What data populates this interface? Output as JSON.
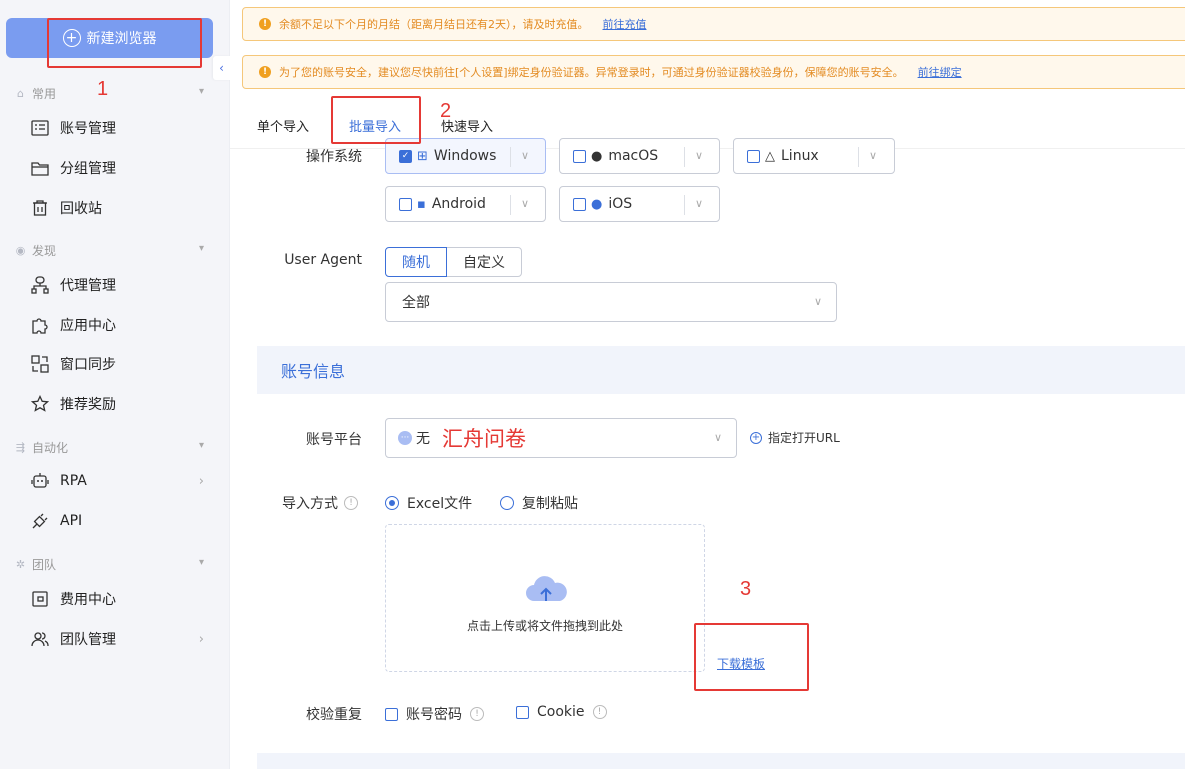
{
  "sidebar": {
    "new_browser": "新建浏览器",
    "groups": [
      {
        "label": "常用",
        "items": [
          "账号管理",
          "分组管理",
          "回收站"
        ]
      },
      {
        "label": "发现",
        "items": [
          "代理管理",
          "应用中心",
          "窗口同步",
          "推荐奖励"
        ]
      },
      {
        "label": "自动化",
        "items": [
          "RPA",
          "API"
        ]
      },
      {
        "label": "团队",
        "items": [
          "费用中心",
          "团队管理"
        ]
      }
    ]
  },
  "alerts": {
    "balance": {
      "text": "余额不足以下个月的月结（距离月结日还有2天），请及时充值。",
      "link": "前往充值"
    },
    "security": {
      "text": "为了您的账号安全，建议您尽快前往[个人设置]绑定身份验证器。异常登录时，可通过身份验证器校验身份，保障您的账号安全。",
      "link": "前往绑定"
    }
  },
  "tabs": [
    "单个导入",
    "批量导入",
    "快速导入"
  ],
  "form": {
    "os_label": "操作系统",
    "os": [
      "Windows",
      "macOS",
      "Linux",
      "Android",
      "iOS"
    ],
    "ua_label": "User Agent",
    "ua_options": [
      "随机",
      "自定义"
    ],
    "ua_select": "全部",
    "section_title": "账号信息",
    "platform_label": "账号平台",
    "platform_value": "无",
    "platform_handwritten": "汇舟问卷",
    "open_url": "指定打开URL",
    "import_label": "导入方式",
    "import_options": [
      "Excel文件",
      "复制粘贴"
    ],
    "upload_hint": "点击上传或将文件拖拽到此处",
    "download_template": "下载模板",
    "dup_label": "校验重复",
    "dup_options": [
      "账号密码",
      "Cookie"
    ]
  },
  "annotations": {
    "n1": "1",
    "n2": "2",
    "n3": "3"
  },
  "colors": {
    "primary": "#3b6fd8",
    "annotation_red": "#e53935",
    "warning": "#f0a020"
  }
}
